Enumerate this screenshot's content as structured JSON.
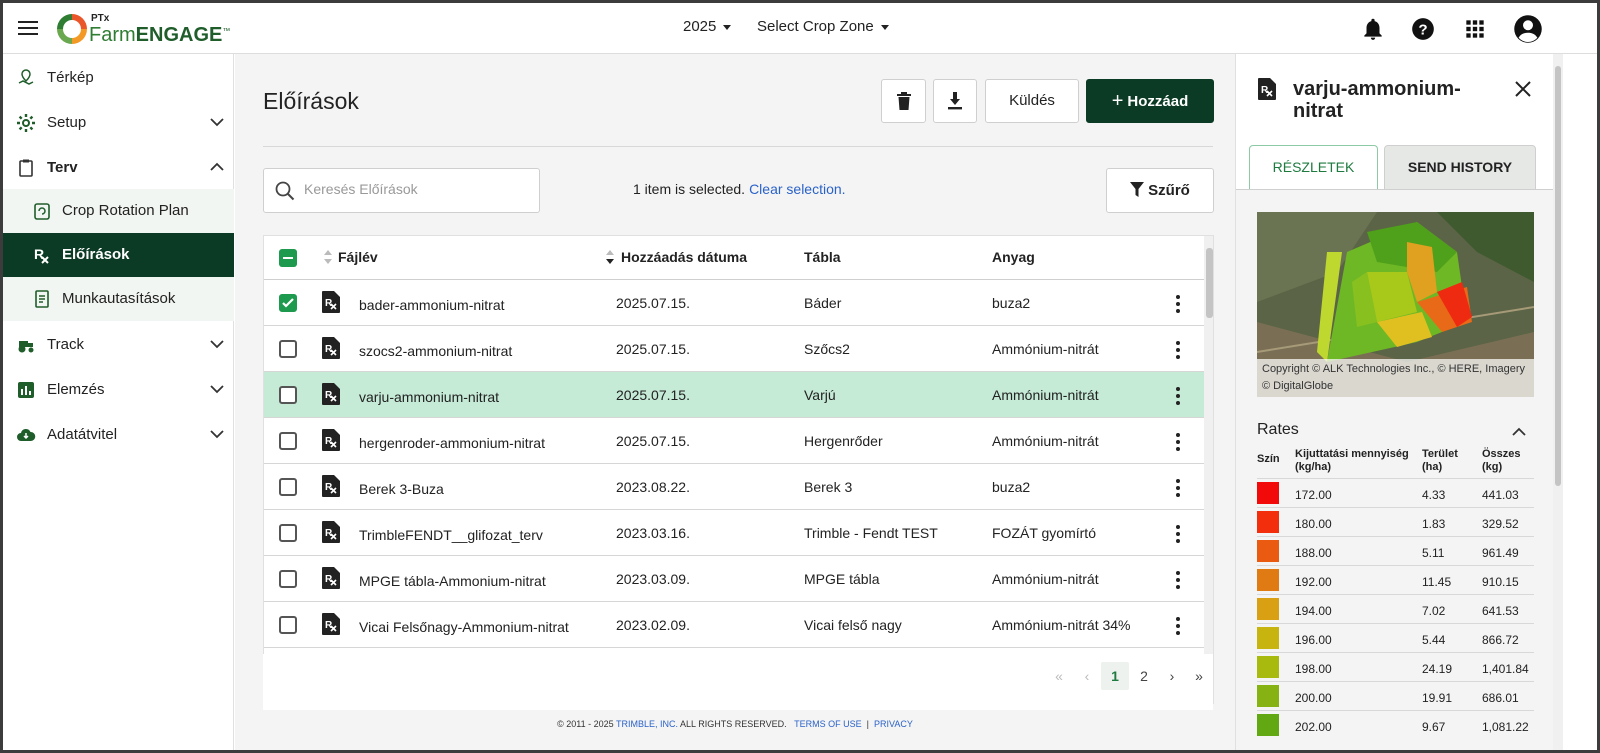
{
  "header": {
    "logo_ptx": "PTx",
    "logo_farm": "Farm",
    "logo_engage": "ENGAGE",
    "logo_tm": "™",
    "year": "2025",
    "crop_zone": "Select Crop Zone",
    "icons": [
      "menu-icon",
      "bell-icon",
      "help-icon",
      "apps-grid-icon",
      "account-icon"
    ]
  },
  "sidebar": {
    "items": [
      {
        "label": "Térkép",
        "icon": "map-pin-icon"
      },
      {
        "label": "Setup",
        "icon": "gear-icon"
      },
      {
        "label": "Terv",
        "icon": "clipboard-icon"
      },
      {
        "label": "Track",
        "icon": "tractor-icon"
      },
      {
        "label": "Elemzés",
        "icon": "chart-icon"
      },
      {
        "label": "Adatátvitel",
        "icon": "cloud-download-icon"
      }
    ],
    "subitems": [
      {
        "label": "Crop Rotation Plan",
        "icon": "rotation-icon"
      },
      {
        "label": "Előírások",
        "icon": "rx-icon"
      },
      {
        "label": "Munkautasítások",
        "icon": "document-icon"
      }
    ]
  },
  "main": {
    "title": "Előírások",
    "send_label": "Küldés",
    "add_label": "Hozzáad",
    "search_placeholder": "Keresés Előírások",
    "selection_text": "1 item is selected.",
    "clear_selection": "Clear selection.",
    "filter_label": "Szűrő",
    "columns": {
      "file": "Fájlév",
      "date": "Hozzáadás dátuma",
      "field": "Tábla",
      "material": "Anyag"
    },
    "rows": [
      {
        "name": "bader-ammonium-nitrat",
        "date": "2025.07.15.",
        "field": "Báder",
        "material": "buza2",
        "checked": true
      },
      {
        "name": "szocs2-ammonium-nitrat",
        "date": "2025.07.15.",
        "field": "Szőcs2",
        "material": "Ammónium-nitrát",
        "checked": false
      },
      {
        "name": "varju-ammonium-nitrat",
        "date": "2025.07.15.",
        "field": "Varjú",
        "material": "Ammónium-nitrát",
        "checked": false,
        "highlighted": true
      },
      {
        "name": "hergenroder-ammonium-nitrat",
        "date": "2025.07.15.",
        "field": "Hergenrőder",
        "material": "Ammónium-nitrát",
        "checked": false
      },
      {
        "name": "Berek 3-Buza",
        "date": "2023.08.22.",
        "field": "Berek 3",
        "material": "buza2",
        "checked": false
      },
      {
        "name": "TrimbleFENDT__glifozat_terv",
        "date": "2023.03.16.",
        "field": "Trimble - Fendt TEST",
        "material": "FOZÁT gyomírtó",
        "checked": false
      },
      {
        "name": "MPGE tábla-Ammonium-nitrat",
        "date": "2023.03.09.",
        "field": "MPGE tábla",
        "material": "Ammónium-nitrát",
        "checked": false
      },
      {
        "name": "Vicai Felsőnagy-Ammonium-nitrat",
        "date": "2023.02.09.",
        "field": "Vicai felső nagy",
        "material": "Ammónium-nitrát 34%",
        "checked": false
      }
    ],
    "pager": {
      "first": "«",
      "prev": "‹",
      "pages": [
        "1",
        "2"
      ],
      "current": "1",
      "next": "›",
      "last": "»"
    },
    "footer": {
      "copy": "© 2011 - 2025",
      "company": "TRIMBLE, INC.",
      "rights": "ALL RIGHTS RESERVED.",
      "terms": "TERMS OF USE",
      "sep": "|",
      "privacy": "PRIVACY"
    }
  },
  "panel": {
    "title": "varju-ammonium-nitrat",
    "tab_details": "RÉSZLETEK",
    "tab_history": "SEND HISTORY",
    "map_copyright": "Copyright © ALK Technologies Inc., © HERE, Imagery © DigitalGlobe",
    "rates_title": "Rates",
    "rates_headers": {
      "color": "Szín",
      "rate": "Kijuttatási mennyiség (kg/ha)",
      "area": "Terület (ha)",
      "total": "Összes (kg)"
    },
    "rates": [
      {
        "color": "#f20a0a",
        "rate": "172.00",
        "area": "4.33",
        "total": "441.03"
      },
      {
        "color": "#f22e0c",
        "rate": "180.00",
        "area": "1.83",
        "total": "329.52"
      },
      {
        "color": "#ea5a10",
        "rate": "188.00",
        "area": "5.11",
        "total": "961.49"
      },
      {
        "color": "#e07a12",
        "rate": "192.00",
        "area": "11.45",
        "total": "910.15"
      },
      {
        "color": "#d8a012",
        "rate": "194.00",
        "area": "7.02",
        "total": "641.53"
      },
      {
        "color": "#c8b40e",
        "rate": "196.00",
        "area": "5.44",
        "total": "866.72"
      },
      {
        "color": "#a8ba0e",
        "rate": "198.00",
        "area": "24.19",
        "total": "1,401.84"
      },
      {
        "color": "#86b214",
        "rate": "200.00",
        "area": "19.91",
        "total": "686.01"
      },
      {
        "color": "#62a812",
        "rate": "202.00",
        "area": "9.67",
        "total": "1,081.22"
      }
    ]
  }
}
